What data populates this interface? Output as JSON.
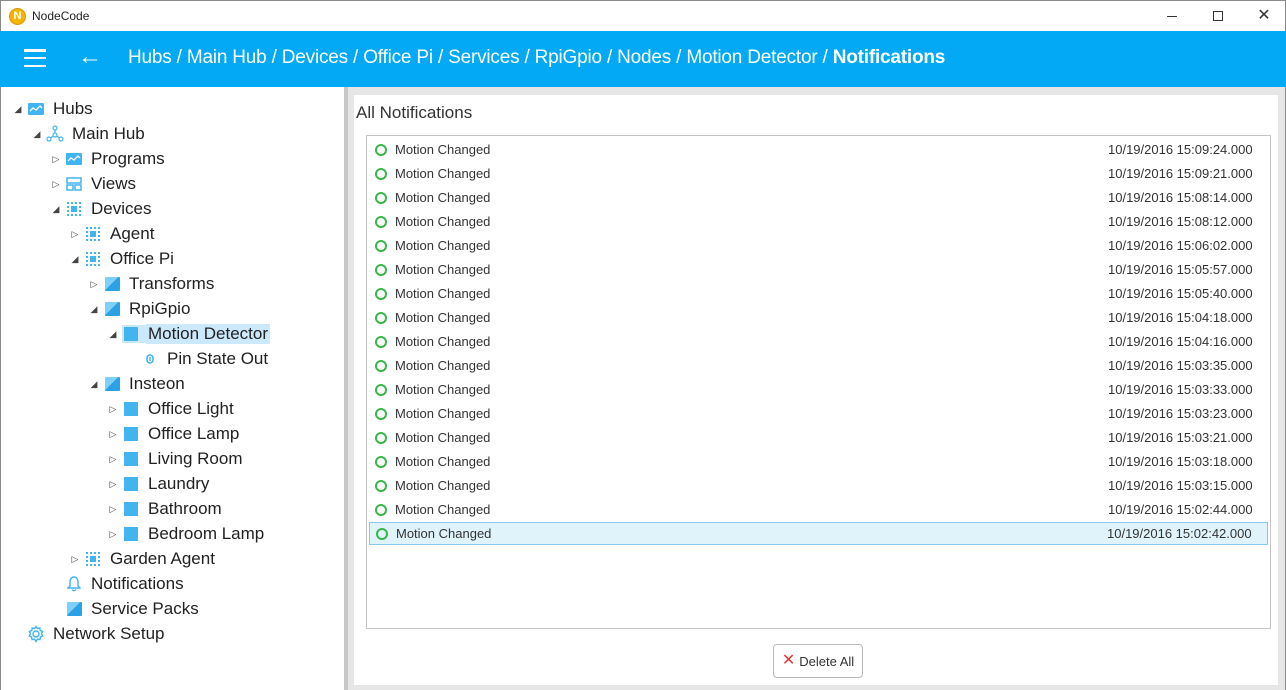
{
  "window": {
    "app_icon_letter": "N",
    "title": "NodeCode",
    "minimize_glyph": "",
    "close_glyph": "✕"
  },
  "header": {
    "back_glyph": "←",
    "breadcrumb": [
      "Hubs",
      "Main Hub",
      "Devices",
      "Office Pi",
      "Services",
      "RpiGpio",
      "Nodes",
      "Motion Detector"
    ],
    "separator": " / ",
    "current": "Notifications"
  },
  "tree": {
    "items": [
      {
        "label": "Hubs",
        "icon": "hub-icon",
        "expanded": true
      },
      {
        "label": "Main Hub",
        "icon": "network-icon",
        "expanded": true
      },
      {
        "label": "Programs",
        "icon": "programs-icon",
        "expanded": false
      },
      {
        "label": "Views",
        "icon": "views-icon",
        "expanded": false
      },
      {
        "label": "Devices",
        "icon": "chip-icon",
        "expanded": true
      },
      {
        "label": "Agent",
        "icon": "chip-icon",
        "expanded": false
      },
      {
        "label": "Office Pi",
        "icon": "chip-icon",
        "expanded": true
      },
      {
        "label": "Transforms",
        "icon": "cube-icon",
        "expanded": false
      },
      {
        "label": "RpiGpio",
        "icon": "cube-icon",
        "expanded": true
      },
      {
        "label": "Motion Detector",
        "icon": "square-icon",
        "expanded": true,
        "selected": true
      },
      {
        "label": "Pin State Out",
        "icon": "pin-icon"
      },
      {
        "label": "Insteon",
        "icon": "cube-icon",
        "expanded": true
      },
      {
        "label": "Office Light",
        "icon": "square-icon",
        "expanded": false
      },
      {
        "label": "Office Lamp",
        "icon": "square-icon",
        "expanded": false
      },
      {
        "label": "Living Room",
        "icon": "square-icon",
        "expanded": false
      },
      {
        "label": "Laundry",
        "icon": "square-icon",
        "expanded": false
      },
      {
        "label": "Bathroom",
        "icon": "square-icon",
        "expanded": false
      },
      {
        "label": "Bedroom Lamp",
        "icon": "square-icon",
        "expanded": false
      },
      {
        "label": "Garden Agent",
        "icon": "chip-icon",
        "expanded": false
      },
      {
        "label": "Notifications",
        "icon": "bell-icon"
      },
      {
        "label": "Service Packs",
        "icon": "cube-icon"
      },
      {
        "label": "Network Setup",
        "icon": "gear-icon"
      }
    ]
  },
  "main": {
    "title": "All Notifications",
    "notifications": [
      {
        "message": "Motion Changed",
        "time": "10/19/2016 15:09:24.000"
      },
      {
        "message": "Motion Changed",
        "time": "10/19/2016 15:09:21.000"
      },
      {
        "message": "Motion Changed",
        "time": "10/19/2016 15:08:14.000"
      },
      {
        "message": "Motion Changed",
        "time": "10/19/2016 15:08:12.000"
      },
      {
        "message": "Motion Changed",
        "time": "10/19/2016 15:06:02.000"
      },
      {
        "message": "Motion Changed",
        "time": "10/19/2016 15:05:57.000"
      },
      {
        "message": "Motion Changed",
        "time": "10/19/2016 15:05:40.000"
      },
      {
        "message": "Motion Changed",
        "time": "10/19/2016 15:04:18.000"
      },
      {
        "message": "Motion Changed",
        "time": "10/19/2016 15:04:16.000"
      },
      {
        "message": "Motion Changed",
        "time": "10/19/2016 15:03:35.000"
      },
      {
        "message": "Motion Changed",
        "time": "10/19/2016 15:03:33.000"
      },
      {
        "message": "Motion Changed",
        "time": "10/19/2016 15:03:23.000"
      },
      {
        "message": "Motion Changed",
        "time": "10/19/2016 15:03:21.000"
      },
      {
        "message": "Motion Changed",
        "time": "10/19/2016 15:03:18.000"
      },
      {
        "message": "Motion Changed",
        "time": "10/19/2016 15:03:15.000"
      },
      {
        "message": "Motion Changed",
        "time": "10/19/2016 15:02:44.000"
      },
      {
        "message": "Motion Changed",
        "time": "10/19/2016 15:02:42.000",
        "selected": true
      }
    ],
    "delete_all_label": "Delete All"
  },
  "colors": {
    "accent": "#03a9f4",
    "icon_blue": "#42b4ef",
    "status_green": "#3cb54a",
    "selection": "#cce8fb",
    "delete_red": "#e53935"
  }
}
